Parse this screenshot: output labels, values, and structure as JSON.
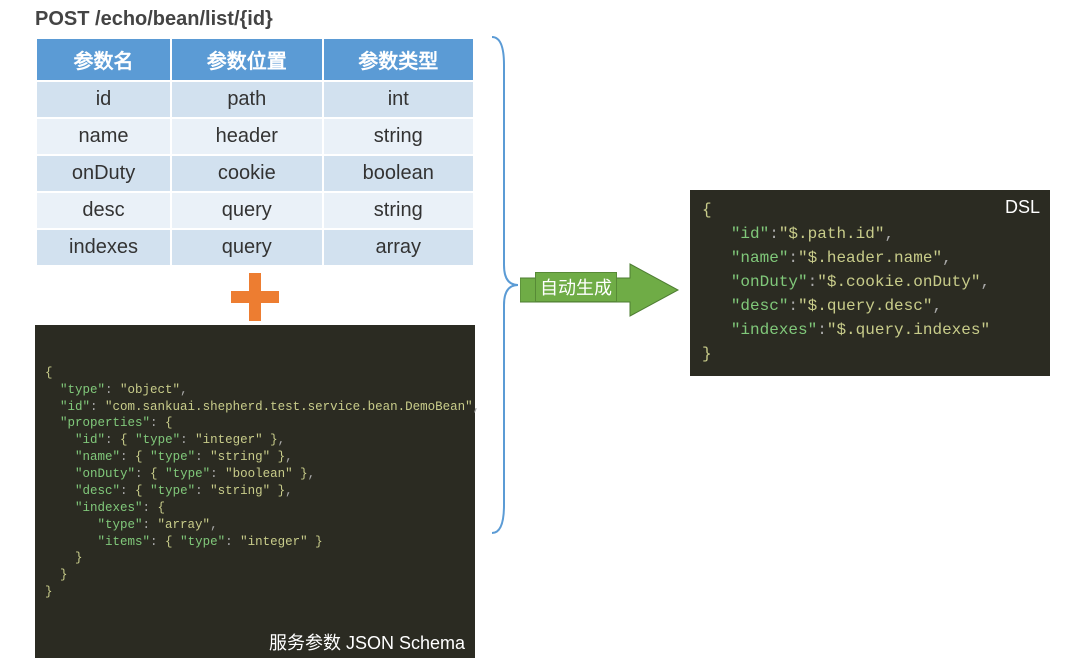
{
  "api": {
    "method": "POST",
    "path": "/echo/bean/list/{id}"
  },
  "table": {
    "headers": [
      "参数名",
      "参数位置",
      "参数类型"
    ],
    "rows": [
      {
        "name": "id",
        "pos": "path",
        "type": "int"
      },
      {
        "name": "name",
        "pos": "header",
        "type": "string"
      },
      {
        "name": "onDuty",
        "pos": "cookie",
        "type": "boolean"
      },
      {
        "name": "desc",
        "pos": "query",
        "type": "string"
      },
      {
        "name": "indexes",
        "pos": "query",
        "type": "array"
      }
    ]
  },
  "plus_icon_name": "plus-icon",
  "schema": {
    "label": "服务参数 JSON Schema",
    "json": {
      "type": "object",
      "id": "com.sankuai.shepherd.test.service.bean.DemoBean",
      "properties": {
        "id": {
          "type": "integer"
        },
        "name": {
          "type": "string"
        },
        "onDuty": {
          "type": "boolean"
        },
        "desc": {
          "type": "string"
        },
        "indexes": {
          "type": "array",
          "items": {
            "type": "integer"
          }
        }
      }
    }
  },
  "arrow": {
    "label": "自动生成",
    "color": "#6fac46"
  },
  "dsl": {
    "label": "DSL",
    "mapping": {
      "id": "$.path.id",
      "name": "$.header.name",
      "onDuty": "$.cookie.onDuty",
      "desc": "$.query.desc",
      "indexes": "$.query.indexes"
    }
  }
}
